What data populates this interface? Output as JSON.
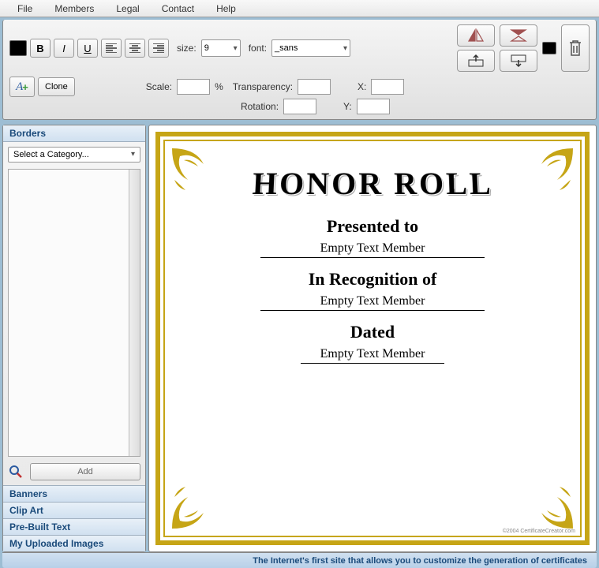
{
  "menu": [
    "File",
    "Members",
    "Legal",
    "Contact",
    "Help"
  ],
  "toolbar": {
    "size_label": "size:",
    "size_value": "9",
    "font_label": "font:",
    "font_value": "_sans",
    "clone": "Clone",
    "scale_label": "Scale:",
    "scale_value": "",
    "percent": "%",
    "transparency_label": "Transparency:",
    "transparency_value": "",
    "rotation_label": "Rotation:",
    "rotation_value": "",
    "x_label": "X:",
    "x_value": "",
    "y_label": "Y:",
    "y_value": ""
  },
  "sidebar": {
    "active": "Borders",
    "category_placeholder": "Select a Category...",
    "add": "Add",
    "panels": [
      "Banners",
      "Clip Art",
      "Pre-Built Text",
      "My Uploaded Images"
    ]
  },
  "certificate": {
    "title": "HONOR ROLL",
    "line1": "Presented to",
    "field1": "Empty Text Member",
    "line2": "In Recognition of",
    "field2": "Empty Text Member",
    "line3": "Dated",
    "field3": "Empty Text Member",
    "copyright": "©2004 CertificateCreator.com"
  },
  "footer": "The Internet's first site that allows you to customize the generation of certificates"
}
